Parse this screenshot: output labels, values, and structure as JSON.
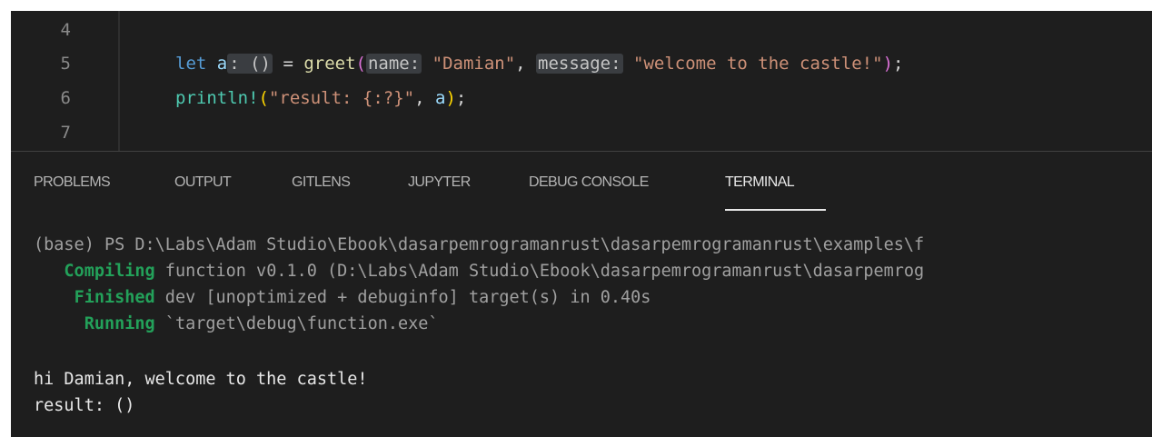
{
  "editor": {
    "line_numbers": [
      "4",
      "5",
      "6",
      "7"
    ],
    "line5": {
      "let": "let",
      "var": "a",
      "type_hint": ": ()",
      "eq": " = ",
      "fn": "greet",
      "open": "(",
      "param1_hint": "name:",
      "arg1": "\"Damian\"",
      "comma": ", ",
      "param2_hint": "message:",
      "arg2": "\"welcome to the castle!\"",
      "close": ")",
      "semi": ";"
    },
    "line6": {
      "macro": "println!",
      "open": "(",
      "fmt": "\"result: {:?}\"",
      "comma": ", ",
      "arg": "a",
      "close": ")",
      "semi": ";"
    }
  },
  "panel": {
    "tabs": [
      "PROBLEMS",
      "OUTPUT",
      "GITLENS",
      "JUPYTER",
      "DEBUG CONSOLE",
      "TERMINAL"
    ],
    "active_tab": "TERMINAL"
  },
  "terminal": {
    "prompt_line": "(base) PS D:\\Labs\\Adam Studio\\Ebook\\dasarpemrogramanrust\\dasarpemrogramanrust\\examples\\f",
    "compiling_kw": "Compiling",
    "compiling_rest": " function v0.1.0 (D:\\Labs\\Adam Studio\\Ebook\\dasarpemrogramanrust\\dasarpemrog",
    "finished_kw": "Finished",
    "finished_rest": " dev [unoptimized + debuginfo] target(s) in 0.40s",
    "running_kw": "Running",
    "running_rest": " `target\\debug\\function.exe`",
    "output_line1": "hi Damian, welcome to the castle!",
    "output_line2": "result: ()"
  },
  "colors": {
    "background": "#1e1e1e",
    "keyword": "#569cd6",
    "variable": "#9cdcfe",
    "function": "#dcdcaa",
    "macro": "#4ec9b0",
    "string": "#ce9178",
    "cargo_status": "#23a15a"
  }
}
